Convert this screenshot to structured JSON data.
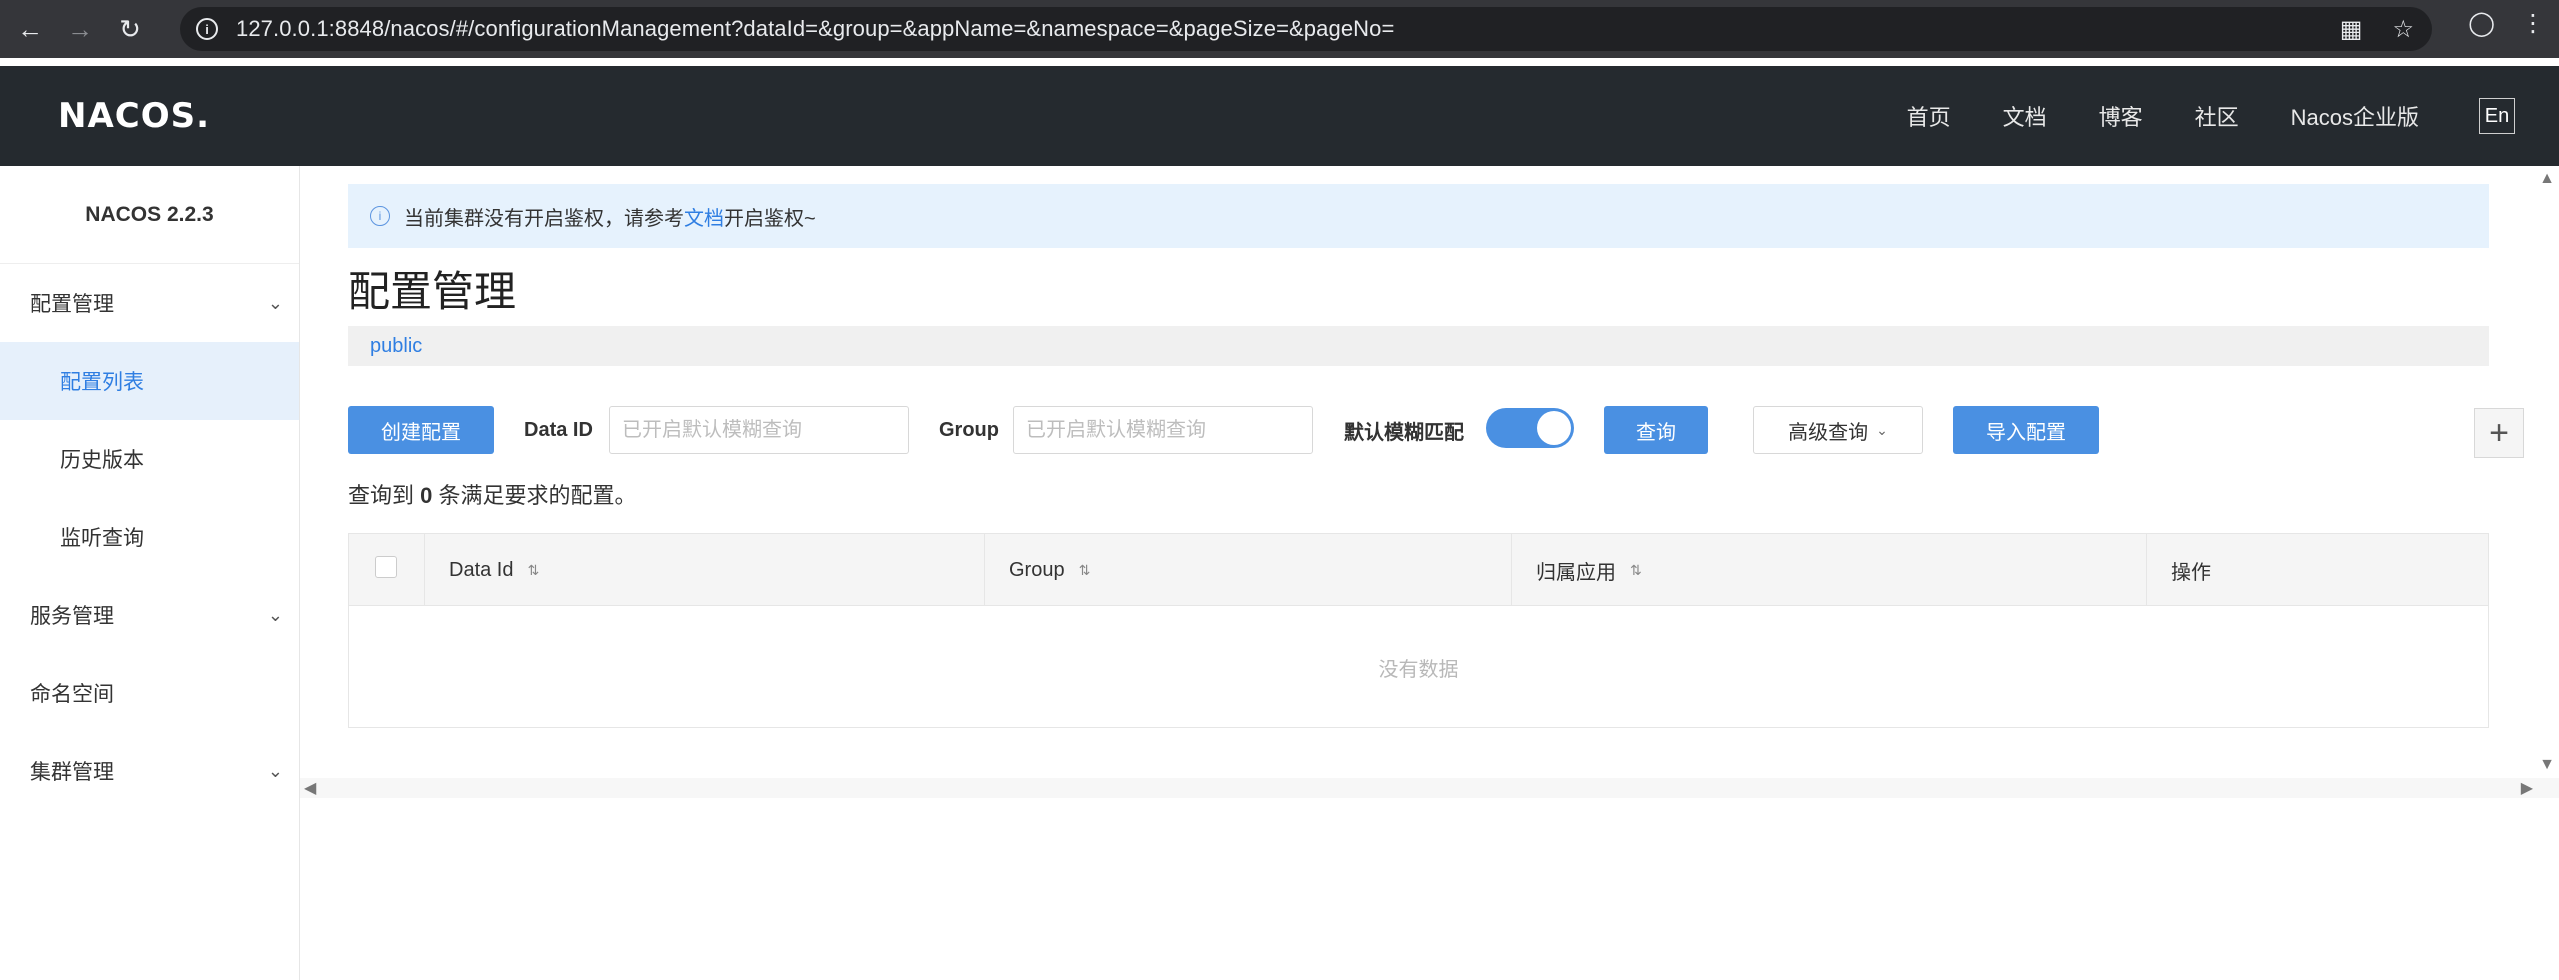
{
  "browser": {
    "url": "127.0.0.1:8848/nacos/#/configurationManagement?dataId=&group=&appName=&namespace=&pageSize=&pageNo="
  },
  "header": {
    "logo": "NACOS.",
    "nav": [
      "首页",
      "文档",
      "博客",
      "社区",
      "Nacos企业版"
    ],
    "lang": "En"
  },
  "sidebar": {
    "version": "NACOS 2.2.3",
    "items": [
      {
        "label": "配置管理"
      },
      {
        "label": "配置列表"
      },
      {
        "label": "历史版本"
      },
      {
        "label": "监听查询"
      },
      {
        "label": "服务管理"
      },
      {
        "label": "命名空间"
      },
      {
        "label": "集群管理"
      }
    ]
  },
  "main": {
    "alert_prefix": "当前集群没有开启鉴权，请参考",
    "alert_link": "文档",
    "alert_suffix": "开启鉴权~",
    "title": "配置管理",
    "namespace": "public",
    "filters": {
      "create_btn": "创建配置",
      "dataid_label": "Data ID",
      "dataid_placeholder": "已开启默认模糊查询",
      "group_label": "Group",
      "group_placeholder": "已开启默认模糊查询",
      "fuzzy_label": "默认模糊匹配",
      "query_btn": "查询",
      "advanced_btn": "高级查询",
      "import_btn": "导入配置"
    },
    "result_prefix": "查询到",
    "result_count": "0",
    "result_suffix": "条满足要求的配置。",
    "table": {
      "columns": [
        "Data Id",
        "Group",
        "归属应用",
        "操作"
      ],
      "empty": "没有数据"
    }
  }
}
